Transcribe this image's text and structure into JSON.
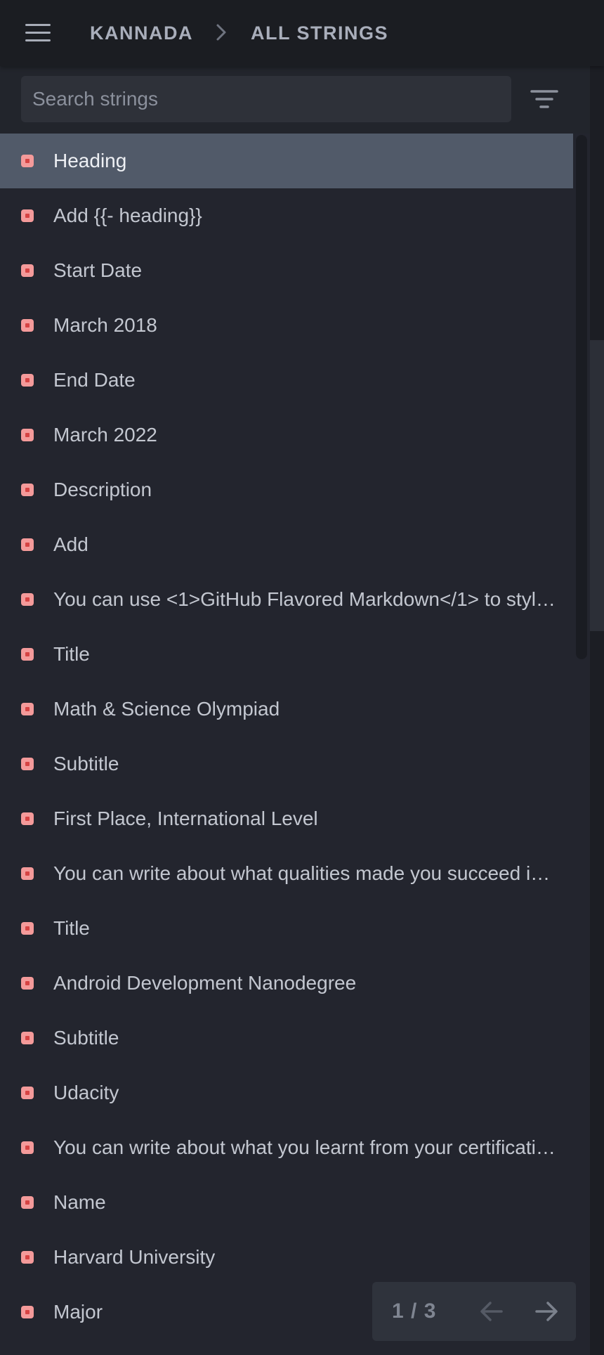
{
  "header": {
    "menu_icon": "hamburger-menu-icon",
    "breadcrumb": {
      "language": "KANNADA",
      "separator_icon": "chevron-right-icon",
      "section": "ALL STRINGS"
    }
  },
  "search": {
    "placeholder": "Search strings",
    "value": "",
    "filter_icon": "filter-icon"
  },
  "colors": {
    "header_bg": "#1b1d22",
    "page_bg": "#23252e",
    "selected_row_bg": "#515a69",
    "status_untranslated": "#f49a9a",
    "text": "#c3c7d0"
  },
  "strings": {
    "selected_index": 0,
    "items": [
      {
        "label": "Heading"
      },
      {
        "label": "Add {{- heading}}"
      },
      {
        "label": "Start Date"
      },
      {
        "label": "March 2018"
      },
      {
        "label": "End Date"
      },
      {
        "label": "March 2022"
      },
      {
        "label": "Description"
      },
      {
        "label": "Add"
      },
      {
        "label": "You can use <1>GitHub Flavored Markdown</1> to style…"
      },
      {
        "label": "Title"
      },
      {
        "label": "Math & Science Olympiad"
      },
      {
        "label": "Subtitle"
      },
      {
        "label": "First Place, International Level"
      },
      {
        "label": "You can write about what qualities made you succeed in…"
      },
      {
        "label": "Title"
      },
      {
        "label": "Android Development Nanodegree"
      },
      {
        "label": "Subtitle"
      },
      {
        "label": "Udacity"
      },
      {
        "label": "You can write about what you learnt from your certificati…"
      },
      {
        "label": "Name"
      },
      {
        "label": "Harvard University"
      },
      {
        "label": "Major"
      }
    ]
  },
  "pagination": {
    "current": "1 / 3",
    "prev_icon": "arrow-left-icon",
    "next_icon": "arrow-right-icon"
  }
}
